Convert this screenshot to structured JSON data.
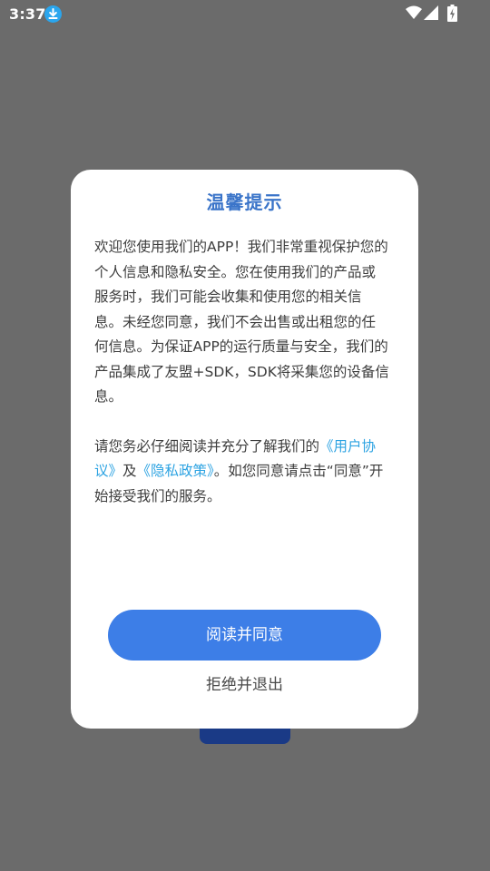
{
  "status_bar": {
    "time": "3:37",
    "icons": [
      "download-icon",
      "wifi-icon",
      "signal-icon",
      "battery-charging-icon"
    ]
  },
  "dialog": {
    "title": "温馨提示",
    "paragraph1": "欢迎您使用我们的APP！我们非常重视保护您的个人信息和隐私安全。您在使用我们的产品或服务时，我们可能会收集和使用您的相关信息。未经您同意，我们不会出售或出租您的任何信息。为保证APP的运行质量与安全，我们的产品集成了友盟+SDK，SDK将采集您的设备信息。",
    "paragraph2_prefix": "请您务必仔细阅读并充分了解我们的",
    "user_agreement_link": "《用户协议》",
    "and_text": "及",
    "privacy_policy_link": "《隐私政策》",
    "paragraph2_suffix": "。如您同意请点击“同意”开始接受我们的服务。",
    "agree_button": "阅读并同意",
    "reject_button": "拒绝并退出"
  },
  "colors": {
    "accent": "#3d7ee7",
    "title": "#3a74c9",
    "link": "#2da3e2",
    "overlay": "#6b6b6b"
  }
}
